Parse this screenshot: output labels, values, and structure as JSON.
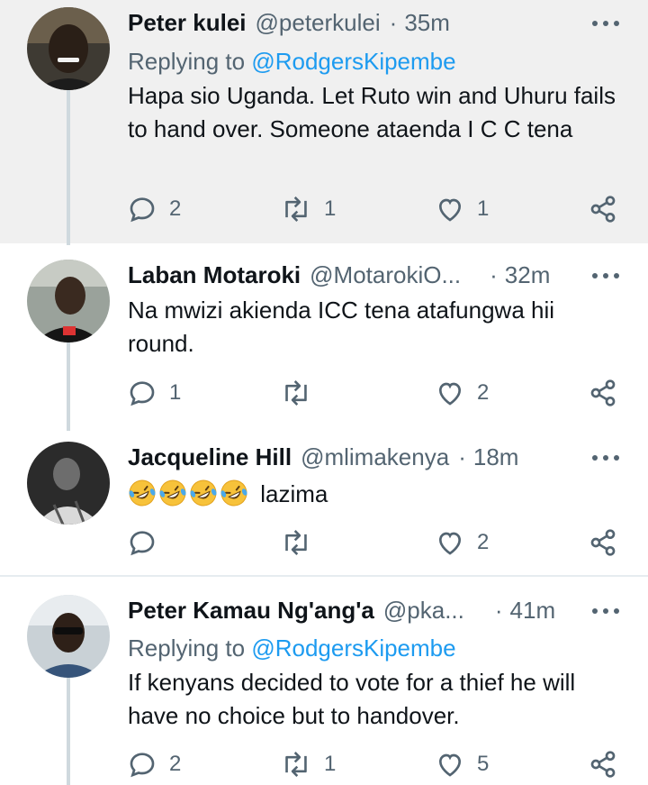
{
  "tweets": [
    {
      "name": "Peter kulei",
      "handle": "@peterkulei",
      "separator": "·",
      "time": "35m",
      "replying_label": "Replying to",
      "replying_to": "@RodgersKipembe",
      "text": "Hapa sio Uganda. Let Ruto win and Uhuru fails to hand over. Someone ataenda I C C tena",
      "replies": "2",
      "retweets": "1",
      "likes": "1"
    },
    {
      "name": "Laban Motaroki",
      "handle": "@MotarokiO...",
      "separator": "·",
      "time": "32m",
      "text": "Na mwizi akienda ICC tena atafungwa hii round.",
      "replies": "1",
      "retweets": "",
      "likes": "2"
    },
    {
      "name": "Jacqueline Hill",
      "handle": "@mlimakenya",
      "separator": "·",
      "time": "18m",
      "text": "lazima",
      "emoji_name": "rolling-on-floor-laughing-emoji",
      "emoji_count": 4,
      "replies": "",
      "retweets": "",
      "likes": "2"
    },
    {
      "name": "Peter Kamau Ng'ang'a",
      "handle": "@pka...",
      "separator": "·",
      "time": "41m",
      "replying_label": "Replying to",
      "replying_to": "@RodgersKipembe",
      "text": "If kenyans decided to vote for a thief he will have no choice but to handover.",
      "replies": "2",
      "retweets": "1",
      "likes": "5"
    }
  ],
  "colors": {
    "highlight_bg": "#f0f0f0",
    "link": "#1d9bf0",
    "secondary": "#536471",
    "thread_line": "#cfd9de"
  },
  "icons": [
    "reply-icon",
    "retweet-icon",
    "like-icon",
    "share-icon",
    "more-icon"
  ]
}
